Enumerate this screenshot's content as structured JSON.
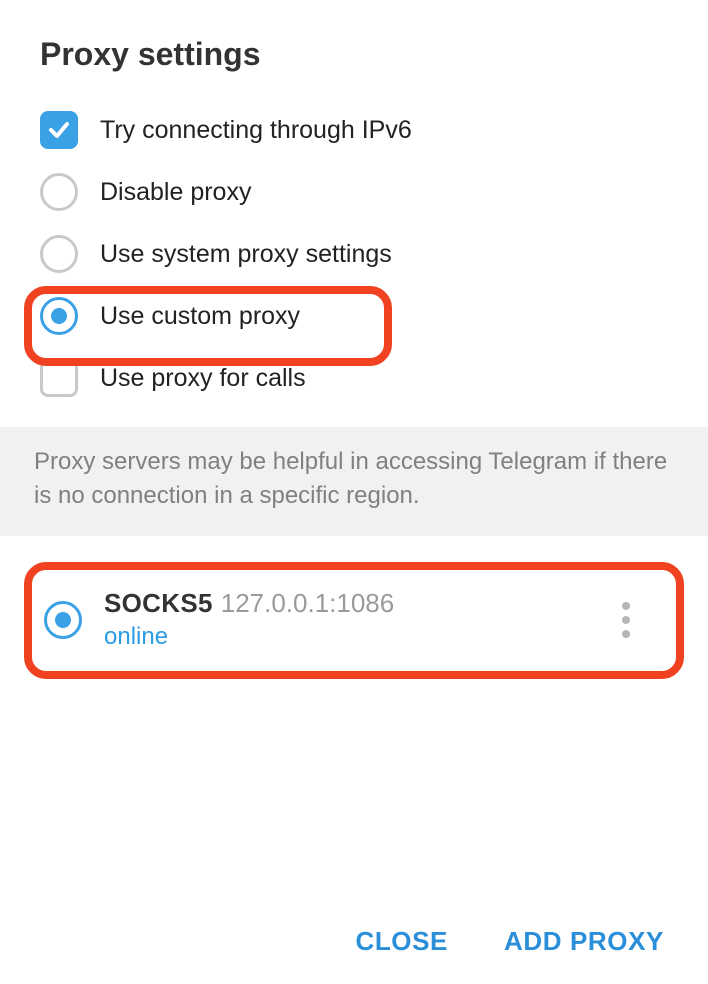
{
  "title": "Proxy settings",
  "options": {
    "ipv6": {
      "label": "Try connecting through IPv6",
      "checked": true
    },
    "disable": {
      "label": "Disable proxy",
      "selected": false
    },
    "system": {
      "label": "Use system proxy settings",
      "selected": false
    },
    "custom": {
      "label": "Use custom proxy",
      "selected": true
    },
    "calls": {
      "label": "Use proxy for calls",
      "checked": false
    }
  },
  "hint": "Proxy servers may be helpful in accessing Telegram if there is no connection in a specific region.",
  "proxies": [
    {
      "type": "SOCKS5",
      "address": "127.0.0.1:1086",
      "status": "online",
      "selected": true
    }
  ],
  "footer": {
    "close": "CLOSE",
    "add": "ADD PROXY"
  }
}
